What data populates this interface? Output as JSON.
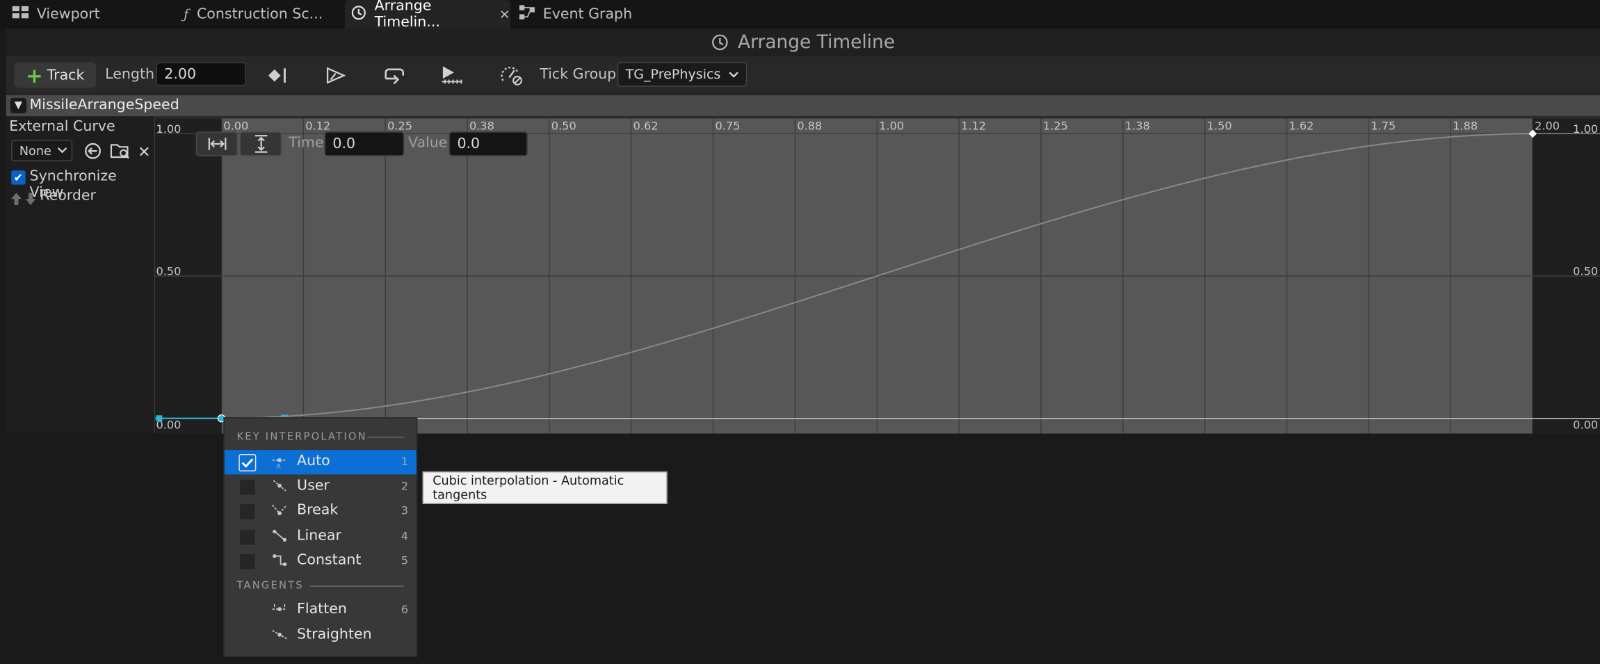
{
  "tabs": [
    {
      "label": "Viewport",
      "icon": "viewport-grid-icon"
    },
    {
      "label": "Construction Sc...",
      "icon": "function-icon"
    },
    {
      "label": "Arrange Timelin...",
      "icon": "clock-icon",
      "active": true,
      "close": "×"
    },
    {
      "label": "Event Graph",
      "icon": "event-graph-icon"
    }
  ],
  "title": "Arrange Timeline",
  "toolbar": {
    "track_label": "Track",
    "length_label": "Length",
    "length_value": "2.00",
    "tick_group_label": "Tick Group",
    "tick_group_value": "TG_PrePhysics"
  },
  "track": {
    "name": "MissileArrangeSpeed",
    "external_curve_label": "External Curve",
    "external_curve_value": "None",
    "synchronize_view_label": "Synchronize View",
    "synchronize_view_checked": true,
    "reorder_label": "Reorder"
  },
  "graph": {
    "time_label": "Time",
    "time_value": "0.0",
    "value_label": "Value",
    "value_value": "0.0",
    "x_ticks": [
      "0.00",
      "0.12",
      "0.25",
      "0.38",
      "0.50",
      "0.62",
      "0.75",
      "0.88",
      "1.00",
      "1.12",
      "1.25",
      "1.38",
      "1.50",
      "1.62",
      "1.75",
      "1.88",
      "2.00"
    ],
    "y_ticks_left": [
      "1.00",
      "0.50",
      "0.00"
    ],
    "y_ticks_right": [
      "1.00",
      "0.50",
      "0.00"
    ]
  },
  "chart_data": {
    "type": "line",
    "xlim": [
      0,
      2
    ],
    "ylim": [
      0,
      1
    ],
    "series": [
      {
        "x": [
          0.0,
          2.0
        ],
        "y": [
          0.0,
          1.0
        ],
        "interp": "cubic-auto"
      }
    ],
    "keys": [
      {
        "time": 0.0,
        "value": 0.0
      },
      {
        "time": 2.0,
        "value": 1.0
      }
    ]
  },
  "menu": {
    "section_interpolation": "KEY INTERPOLATION",
    "items": [
      {
        "label": "Auto",
        "key": "1",
        "checked": true,
        "icon": "auto-tangent-icon"
      },
      {
        "label": "User",
        "key": "2",
        "checked": false,
        "icon": "user-tangent-icon"
      },
      {
        "label": "Break",
        "key": "3",
        "checked": false,
        "icon": "break-tangent-icon"
      },
      {
        "label": "Linear",
        "key": "4",
        "checked": false,
        "icon": "linear-interp-icon"
      },
      {
        "label": "Constant",
        "key": "5",
        "checked": false,
        "icon": "constant-interp-icon"
      }
    ],
    "section_tangents": "TANGENTS",
    "tangent_items": [
      {
        "label": "Flatten",
        "key": "6",
        "icon": "flatten-tangent-icon"
      },
      {
        "label": "Straighten",
        "key": "",
        "icon": "straighten-tangent-icon"
      }
    ]
  },
  "tooltip": "Cubic interpolation - Automatic tangents",
  "colors": {
    "accent": "#0b6fd6",
    "add_green": "#6fc24a",
    "key_cyan": "#2bb7d9",
    "curve_active": "#5a5a5a",
    "curve_inactive": "#1f1f1f"
  }
}
